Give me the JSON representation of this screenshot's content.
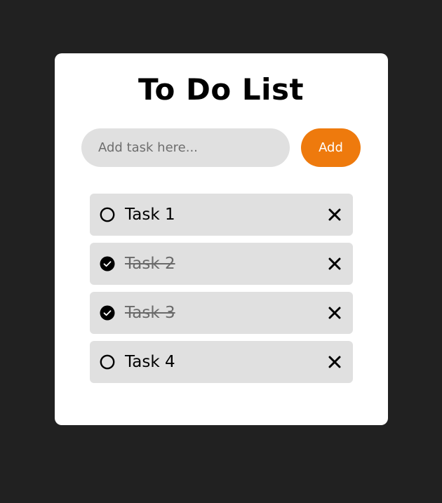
{
  "app": {
    "title": "To Do List"
  },
  "input": {
    "placeholder": "Add task here...",
    "value": ""
  },
  "add_button": {
    "label": "Add"
  },
  "tasks": [
    {
      "label": "Task 1",
      "completed": false,
      "icon": "circle-unchecked-icon"
    },
    {
      "label": "Task 2",
      "completed": true,
      "icon": "check-circle-icon"
    },
    {
      "label": "Task 3",
      "completed": true,
      "icon": "check-circle-icon"
    },
    {
      "label": "Task 4",
      "completed": false,
      "icon": "circle-unchecked-icon"
    }
  ],
  "icons": {
    "delete": "close-icon"
  },
  "colors": {
    "background": "#212121",
    "card": "#ffffff",
    "accent": "#ee7a0d",
    "input_bg": "#e0e0e0",
    "task_bg": "#e0e0e0",
    "done_text": "#6a6a6a"
  }
}
